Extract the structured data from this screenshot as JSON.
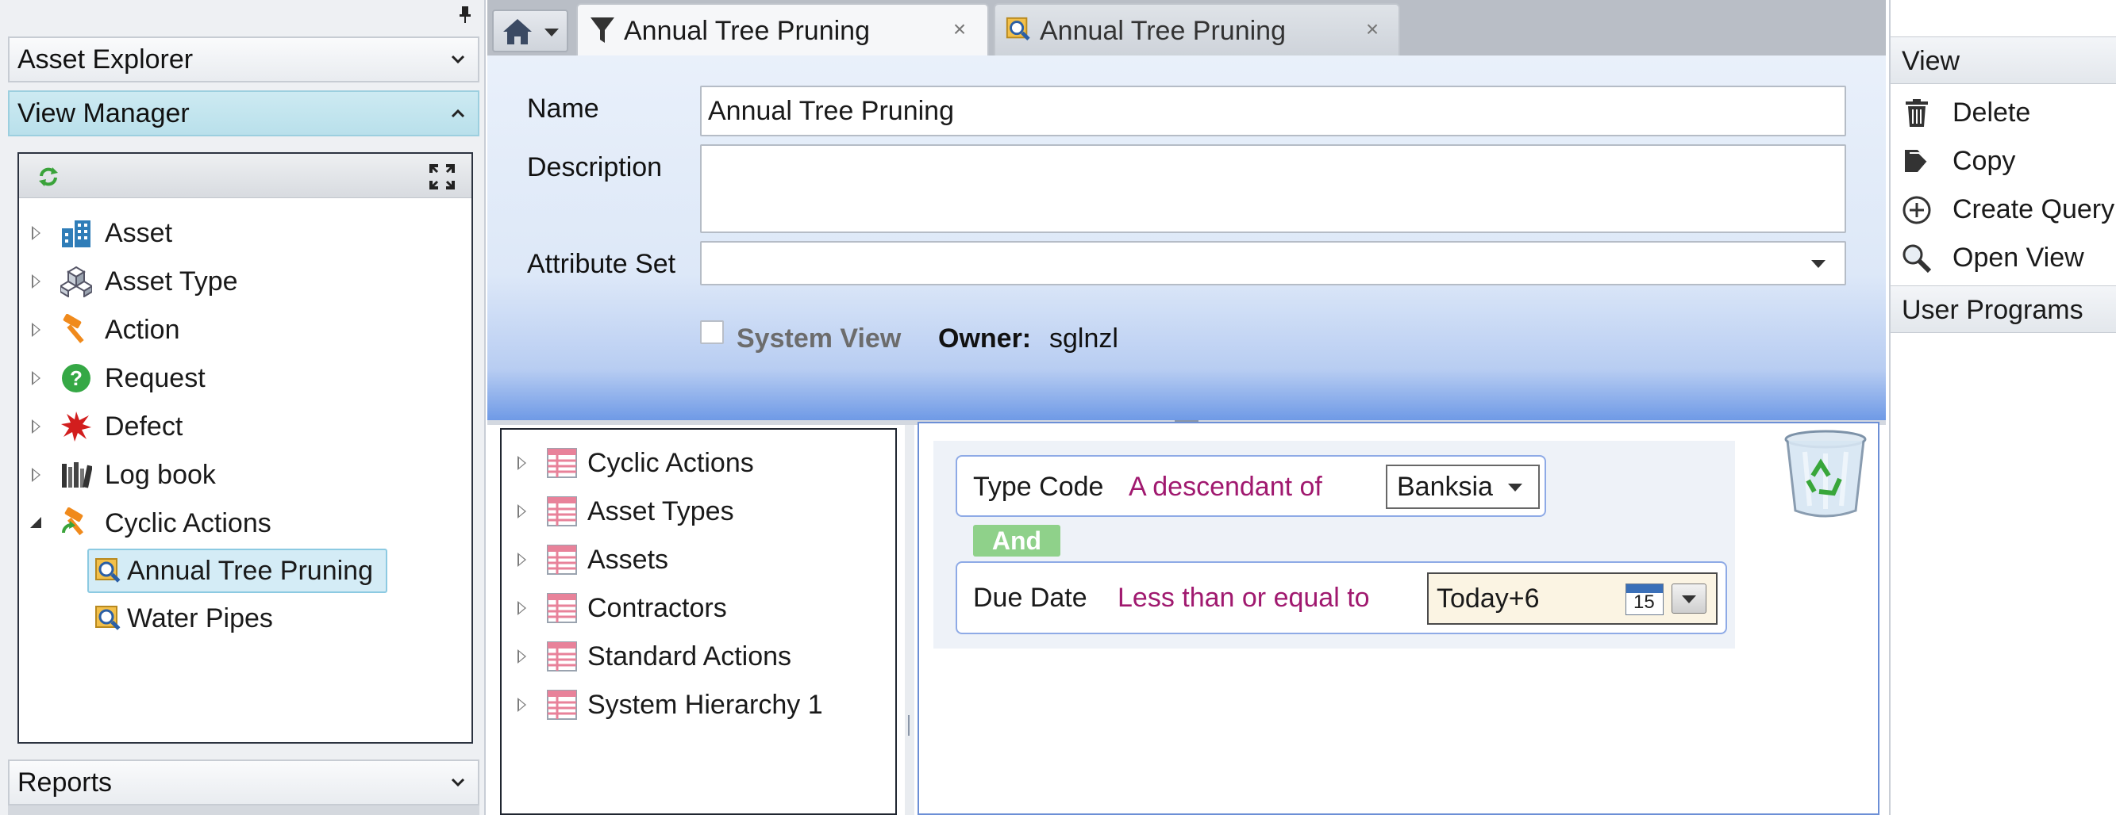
{
  "left_panel": {
    "asset_explorer": "Asset Explorer",
    "view_manager": "View Manager",
    "reports": "Reports",
    "tree": [
      {
        "label": "Asset",
        "icon": "building-icon"
      },
      {
        "label": "Asset Type",
        "icon": "cubes-icon"
      },
      {
        "label": "Action",
        "icon": "hammer-icon"
      },
      {
        "label": "Request",
        "icon": "question-icon"
      },
      {
        "label": "Defect",
        "icon": "splat-icon"
      },
      {
        "label": "Log book",
        "icon": "books-icon"
      },
      {
        "label": "Cyclic Actions",
        "icon": "cyclic-hammer-icon"
      }
    ],
    "children": [
      {
        "label": "Annual Tree Pruning",
        "selected": true
      },
      {
        "label": "Water Pipes",
        "selected": false
      }
    ]
  },
  "tabs": [
    {
      "label": "Annual Tree Pruning",
      "icon": "filter-icon",
      "active": true
    },
    {
      "label": "Annual Tree Pruning",
      "icon": "view-icon",
      "active": false
    }
  ],
  "form": {
    "name_label": "Name",
    "name_value": "Annual Tree Pruning",
    "description_label": "Description",
    "description_value": "",
    "attribute_set_label": "Attribute Set",
    "attribute_set_value": "",
    "system_view_label": "System View",
    "system_view_checked": false,
    "owner_label": "Owner:",
    "owner_value": "sglnzl"
  },
  "sources": [
    "Cyclic Actions",
    "Asset Types",
    "Assets",
    "Contractors",
    "Standard Actions",
    "System Hierarchy 1"
  ],
  "query": {
    "criterion1": {
      "field": "Type Code",
      "operator": "A descendant of",
      "value": "Banksia"
    },
    "conjunction": "And",
    "criterion2": {
      "field": "Due Date",
      "operator": "Less than or equal to",
      "value": "Today+6",
      "calendar_day": "15"
    }
  },
  "right_panel": {
    "view_header": "View",
    "actions": [
      {
        "label": "Delete",
        "icon": "trash-icon"
      },
      {
        "label": "Copy",
        "icon": "copy-icon"
      },
      {
        "label": "Create Query",
        "icon": "plus-circle-icon"
      },
      {
        "label": "Open View",
        "icon": "magnifier-icon"
      }
    ],
    "user_programs": "User Programs"
  },
  "colors": {
    "accent": "#b9e0eb",
    "operator": "#a0196f",
    "and_badge": "#8fd18a",
    "form_gradient_bottom": "#6f9ae6"
  }
}
